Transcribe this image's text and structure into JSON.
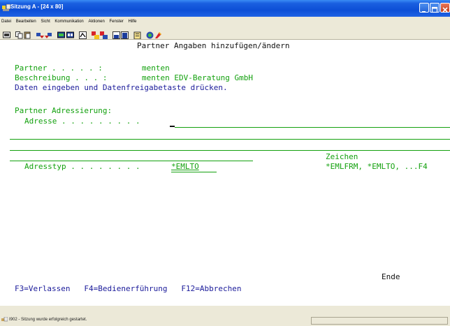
{
  "window": {
    "title": "Sitzung A - [24 x 80]"
  },
  "menu": [
    "Datei",
    "Bearbeiten",
    "Sicht",
    "Kommunikation",
    "Aktionen",
    "Fenster",
    "Hilfe"
  ],
  "toolbar_icons": [
    "print-screen-icon",
    "copy-icon",
    "paste-icon",
    "send-icon",
    "receive-icon",
    "display-icon",
    "keypad-icon",
    "macro-icon",
    "record-icon",
    "play-icon",
    "start-icon",
    "stop-icon",
    "clipboard-icon",
    "connect-icon",
    "color-icon"
  ],
  "screen": {
    "heading": "Partner Angaben hinzufügen/ändern",
    "partner_label": "Partner . . . . . :",
    "partner_value": "menten",
    "description_label": "Beschreibung . . . :",
    "description_value": "menten EDV-Beratung GmbH",
    "instruction": "Daten eingeben und Datenfreigabetaste drücken.",
    "section_label": "Partner Adressierung:",
    "address_label": "Adresse . . . . . . . . .",
    "address_value": "",
    "chars_label": "Zeichen",
    "addrtype_label": "Adresstyp . . . . . . . .",
    "addrtype_value": "*EMLTO",
    "addrtype_options": "*EMLFRM, *EMLTO, ...F4",
    "end_label": "Ende",
    "fkeys": "F3=Verlassen   F4=Bedienerführung   F12=Abbrechen"
  },
  "status": {
    "message": "I902 - Sitzung wurde erfolgreich gestartet."
  },
  "colors": {
    "field_green": "#13a10e",
    "info_blue": "#1b1b9a",
    "titlebar_blue": "#0d4fd6"
  }
}
